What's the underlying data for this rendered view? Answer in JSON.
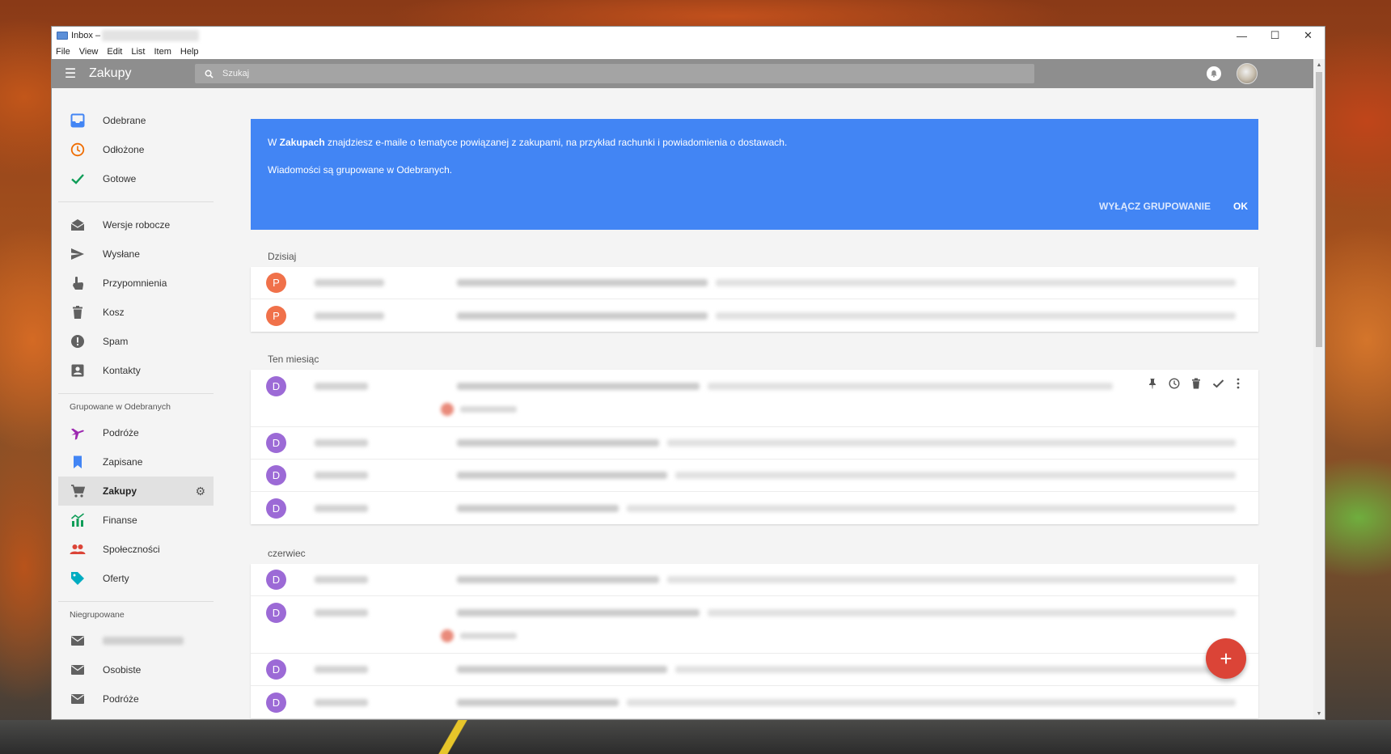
{
  "window": {
    "title": "Inbox –",
    "controls": {
      "minimize": "—",
      "maximize": "☐",
      "close": "✕"
    }
  },
  "menu": [
    "File",
    "View",
    "Edit",
    "List",
    "Item",
    "Help"
  ],
  "appbar": {
    "title": "Zakupy",
    "search_placeholder": "Szukaj",
    "icons": {
      "menu": "hamburger-icon",
      "search": "search-icon",
      "notifications": "bell-icon"
    }
  },
  "sidebar": {
    "primary": [
      {
        "label": "Odebrane",
        "icon": "inbox-icon",
        "color": "#4285f4"
      },
      {
        "label": "Odłożone",
        "icon": "clock-icon",
        "color": "#ef6c00"
      },
      {
        "label": "Gotowe",
        "icon": "checkmark-icon",
        "color": "#0f9d58"
      }
    ],
    "secondary": [
      {
        "label": "Wersje robocze",
        "icon": "drafts-icon"
      },
      {
        "label": "Wysłane",
        "icon": "send-icon"
      },
      {
        "label": "Przypomnienia",
        "icon": "reminder-hand-icon"
      },
      {
        "label": "Kosz",
        "icon": "trash-icon"
      },
      {
        "label": "Spam",
        "icon": "spam-icon"
      },
      {
        "label": "Kontakty",
        "icon": "contacts-icon"
      }
    ],
    "bundled_heading": "Grupowane w Odebranych",
    "bundled": [
      {
        "label": "Podróże",
        "icon": "airplane-icon",
        "color": "#9c27b0"
      },
      {
        "label": "Zapisane",
        "icon": "bookmark-icon",
        "color": "#4285f4"
      },
      {
        "label": "Zakupy",
        "icon": "cart-icon",
        "color": "#616161",
        "active": true
      },
      {
        "label": "Finanse",
        "icon": "finance-chart-icon",
        "color": "#0f9d58"
      },
      {
        "label": "Społeczności",
        "icon": "people-icon",
        "color": "#db4437"
      },
      {
        "label": "Oferty",
        "icon": "tag-icon",
        "color": "#00acc1"
      }
    ],
    "unbundled_heading": "Niegrupowane",
    "unbundled": [
      {
        "label": "",
        "icon": "mail-icon",
        "blurred": true
      },
      {
        "label": "Osobiste",
        "icon": "mail-icon"
      },
      {
        "label": "Podróże",
        "icon": "mail-icon"
      }
    ]
  },
  "banner": {
    "line1_prefix": "W ",
    "line1_bold": "Zakupach",
    "line1_suffix": " znajdziesz e-maile o tematyce powiązanej z zakupami, na przykład rachunki i powiadomienia o dostawach.",
    "line2": "Wiadomości są grupowane w Odebranych.",
    "disable_button": "WYŁĄCZ GRUPOWANIE",
    "ok_button": "OK",
    "color": "#4285f4"
  },
  "sections": [
    {
      "label": "Dzisiaj",
      "rows": [
        {
          "letter": "P",
          "color": "#f0714a"
        },
        {
          "letter": "P",
          "color": "#f0714a"
        }
      ]
    },
    {
      "label": "Ten miesiąc",
      "rows": [
        {
          "letter": "D",
          "color": "#9c6ad6",
          "attachment": true,
          "hover": true
        },
        {
          "letter": "D",
          "color": "#9c6ad6"
        },
        {
          "letter": "D",
          "color": "#9c6ad6"
        },
        {
          "letter": "D",
          "color": "#9c6ad6"
        }
      ]
    },
    {
      "label": "czerwiec",
      "rows": [
        {
          "letter": "D",
          "color": "#9c6ad6"
        },
        {
          "letter": "D",
          "color": "#9c6ad6",
          "attachment": true
        },
        {
          "letter": "D",
          "color": "#9c6ad6"
        },
        {
          "letter": "D",
          "color": "#9c6ad6"
        }
      ]
    }
  ],
  "row_actions": [
    "pin-icon",
    "snooze-clock-icon",
    "delete-icon",
    "done-check-icon",
    "more-vert-icon"
  ],
  "fab": {
    "label": "+",
    "color": "#db4437"
  }
}
